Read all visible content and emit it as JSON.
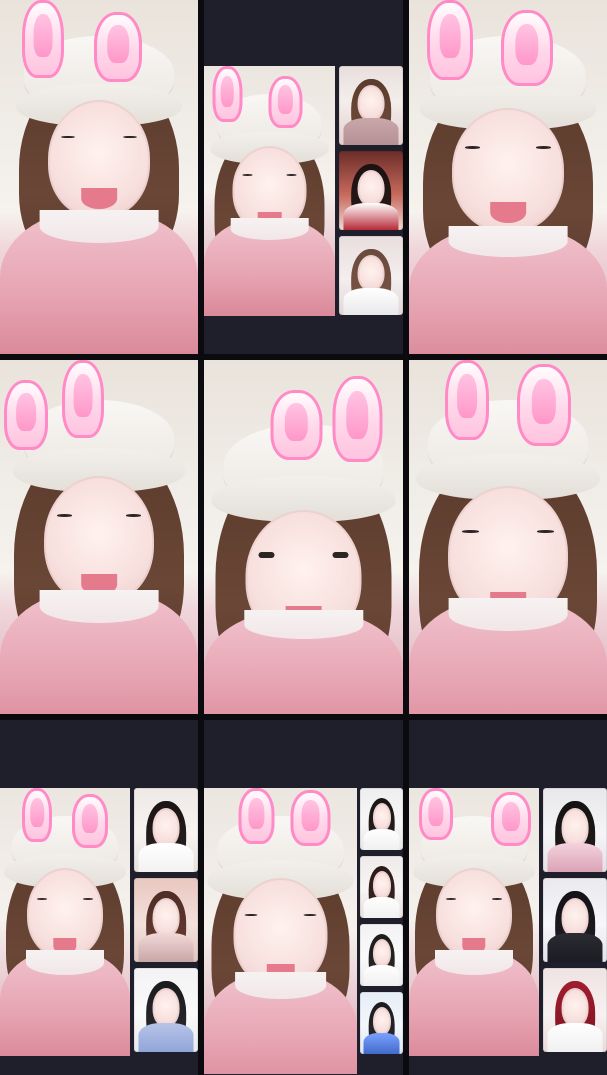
{
  "screen": {
    "grid": {
      "rows": 3,
      "cols": 3
    },
    "cells": [
      {
        "id": "r1c1",
        "layout": "single",
        "decor": "bunny-ears"
      },
      {
        "id": "r1c2",
        "layout": "main-plus-thumbs",
        "thumb_count": 3,
        "decor": "bunny-ears"
      },
      {
        "id": "r1c3",
        "layout": "single",
        "decor": "bunny-ears"
      },
      {
        "id": "r2c1",
        "layout": "single",
        "decor": "bunny-ears"
      },
      {
        "id": "r2c2",
        "layout": "single",
        "decor": "bunny-ears"
      },
      {
        "id": "r2c3",
        "layout": "single",
        "decor": "bunny-ears"
      },
      {
        "id": "r3c1",
        "layout": "main-plus-thumbs",
        "thumb_count": 3,
        "decor": "bunny-ears"
      },
      {
        "id": "r3c2",
        "layout": "main-plus-thumbs",
        "thumb_count": 4,
        "decor": "bunny-ears"
      },
      {
        "id": "r3c3",
        "layout": "main-plus-thumbs",
        "thumb_count": 3,
        "decor": "bunny-ears"
      }
    ]
  },
  "colors": {
    "separator": "#000000",
    "panel": "#1e1f2b",
    "ear_outline": "#ff8ac6",
    "ear_fill": "#ffd7ea"
  }
}
